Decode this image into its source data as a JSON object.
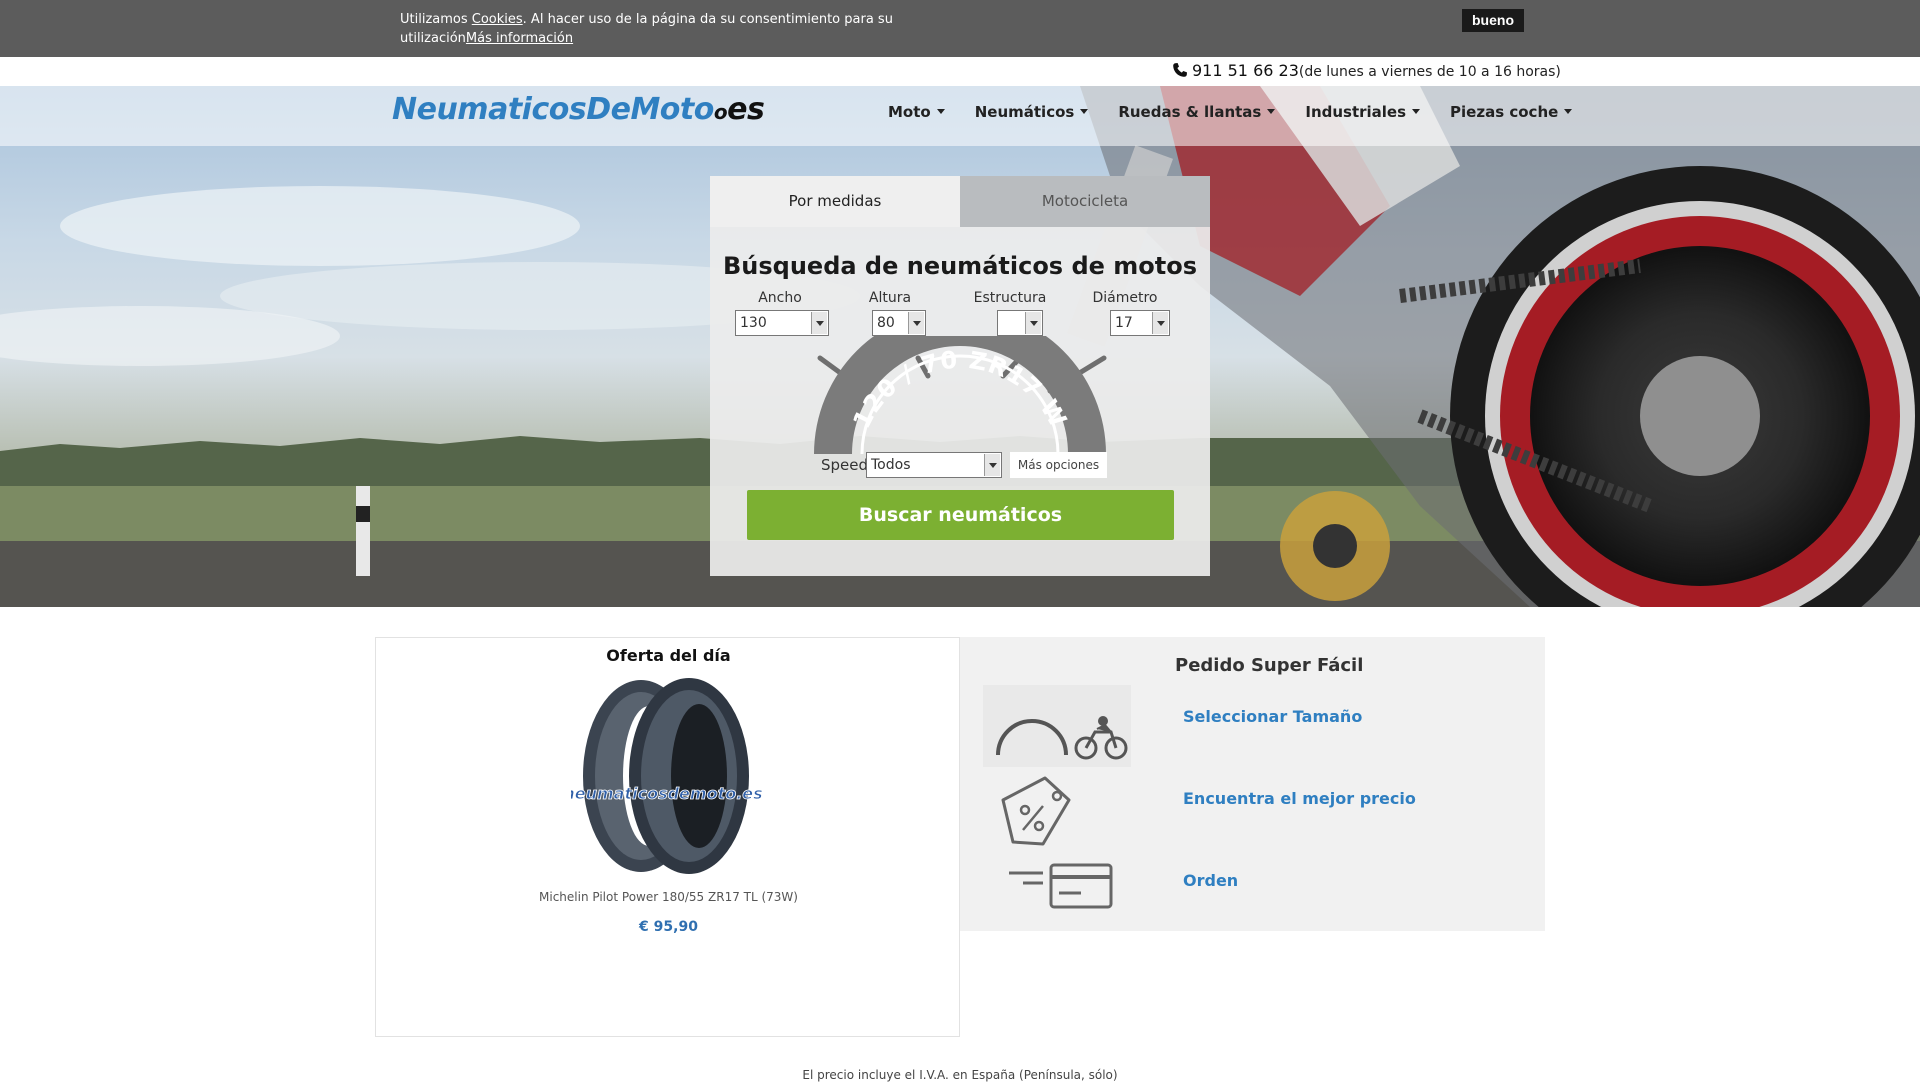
{
  "cookie": {
    "text": "Utilizamos ",
    "link_cookies": "Cookies",
    "text2": ". Al hacer uso de la página da su consentimiento para su utilización",
    "link_more": "Más información",
    "accept_button": "bueno"
  },
  "contact": {
    "phone": "911 51 66 23",
    "hours": "(de lunes a viernes de 10 a 16 horas)"
  },
  "logo": {
    "main": "NeumaticosDeMoto",
    "dot": "o",
    "tld": "es"
  },
  "nav": [
    {
      "label": "Moto"
    },
    {
      "label": "Neumáticos"
    },
    {
      "label": "Ruedas & llantas"
    },
    {
      "label": "Industriales"
    },
    {
      "label": "Piezas coche"
    }
  ],
  "search": {
    "tabs": [
      {
        "label": "Por medidas"
      },
      {
        "label": "Motocicleta"
      }
    ],
    "title": "Búsqueda de neumáticos de motos",
    "fields": {
      "ancho": {
        "label": "Ancho",
        "value": "130"
      },
      "altura": {
        "label": "Altura",
        "value": "80"
      },
      "estructura": {
        "label": "Estructura",
        "value": ""
      },
      "diametro": {
        "label": "Diámetro",
        "value": "17"
      }
    },
    "tire_label": "120 / 70 ZR17 W",
    "speed_label": "Speed",
    "speed_value": "Todos",
    "more_options": "Más opciones",
    "submit": "Buscar neumáticos"
  },
  "offer": {
    "title": "Oferta del día",
    "watermark": "neumaticosdemoto.es",
    "product": "Michelin Pilot Power 180/55 ZR17 TL (73W)",
    "price": "€ 95,90"
  },
  "pedido": {
    "title": "Pedido Super Fácil",
    "steps": [
      {
        "label": "Seleccionar Tamaño",
        "icon": "tire-size-moto-icon"
      },
      {
        "label": "Encuentra el mejor precio",
        "icon": "price-tag-percent-icon"
      },
      {
        "label": "Orden",
        "icon": "credit-card-icon"
      }
    ]
  },
  "footer": {
    "note": "El precio incluye el I.V.A. en España (Península, sólo)"
  }
}
